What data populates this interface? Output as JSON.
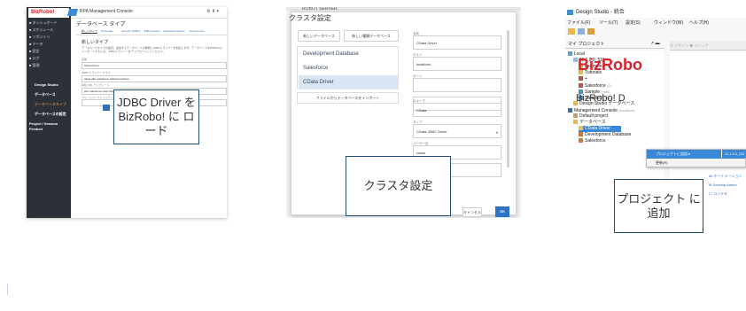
{
  "rpa_console": {
    "logo": "BizRobo!",
    "app_title": "RPA Management Console",
    "user": "⚙ ⬇ ▾",
    "sidebar": [
      "■ ダッシュボード",
      "■ スケジュール",
      "■ リポジトリ",
      "■ データ",
      "■ 設定",
      "■ ログ",
      "■ 管理",
      "Design Studio",
      "データベース",
      "データベースタイプ",
      "データベースの設定",
      "Project / Session Product"
    ],
    "page_title": "データベース タイプ",
    "tabs": [
      "新しいタイプ",
      "Properties",
      "Security (JDBC)",
      "JDBC Feature",
      "Advanced Options",
      "Environment"
    ],
    "section_title": "新しいタイプ",
    "description": "データベースタイプの設定。追加するデータベースの種類とJDBCドライバーを指定します。データベースをBizRoboにインポートするには、JDBCドライバーをアップロードしてください。",
    "fields": [
      {
        "label": "名前",
        "value": "CData Driver"
      },
      {
        "label": "JDBC ドライバークラス",
        "value": "cdata.jdbc.salesforce.SalesforceDriver"
      },
      {
        "label": "接続 URL テンプレート",
        "value": "jdbc:salesforce:User=${user};Password=${password};"
      },
      {
        "label": "フィールド / ファイルアップロード",
        "value": ""
      }
    ]
  },
  "cluster_dialog": {
    "behind_title": "ROBOT SERVER",
    "title": "クラスタ設定",
    "new_db_button": "新しいデータベース",
    "new_mapping_button": "新しい種類データベース",
    "databases": [
      "Development Database",
      "Salesforce",
      "CData Driver"
    ],
    "import_button": "ファイルからデータベースをインポート",
    "fields": [
      {
        "label": "名前",
        "value": "CData Driver"
      },
      {
        "label": "ホスト",
        "value": "localhost"
      },
      {
        "label": "ポート",
        "value": ""
      },
      {
        "label": "",
        "value": ""
      },
      {
        "label": "スキーマ",
        "value": "CData"
      },
      {
        "label": "タイプ",
        "value": "CData JDBC Driver"
      },
      {
        "label": "ユーザー名",
        "value": "cdata"
      }
    ],
    "cancel": "キャンセル",
    "ok": "OK"
  },
  "design_studio": {
    "title": "Design Studio - 統合",
    "menus": [
      "ファイル(F)",
      "ツール(T)",
      "設定(S)",
      "ウィンドウ(W)",
      "ヘルプ(H)"
    ],
    "project_header": "マイ プロジェクト",
    "project_tools": "↗  ▬",
    "tabs": "▦ デザイン  ◆ デバッグ",
    "tree": [
      {
        "text": "Local",
        "muted": ""
      },
      {
        "text": "11.1.0.0_511",
        "muted": ""
      },
      {
        "text": "Examples",
        "muted": ""
      },
      {
        "text": "Tutorials",
        "muted": ""
      },
      {
        "text": "+",
        "muted": ""
      },
      {
        "text": "Salesforce",
        "muted": "(2)"
      },
      {
        "text": "Sample",
        "muted": "(mail)"
      },
      {
        "text": "Sample2",
        "muted": "(data)"
      },
      {
        "text": "Design Studio データベース",
        "muted": ""
      },
      {
        "text": "Management Console",
        "muted": "(localhost)"
      },
      {
        "text": "Default project",
        "muted": ""
      },
      {
        "text": "データベース",
        "muted": ""
      },
      {
        "text": "CData Driver",
        "muted": ""
      },
      {
        "text": "Development Database",
        "muted": ""
      },
      {
        "text": "Salesforce",
        "muted": ""
      }
    ],
    "context_menu": [
      "プロジェクトに追加  ▸",
      "更新(R)"
    ],
    "submenu": "11.1.0.0_511",
    "brand_top": "BizRobo",
    "brand_bottom": "BizRobo! D",
    "editor_links": [
      "eb オートメーション",
      "⊕ Desktop Autom",
      "い コンテキ"
    ]
  },
  "callouts": {
    "jdbc": "JDBC Driver をBizRobo! に ロード",
    "cluster": "クラスタ設定",
    "project": "プロジェクト に追加"
  },
  "colors": {
    "brand_red": "#d8232a",
    "accent_blue": "#2f73c6",
    "callout_border": "#1f4e79"
  }
}
